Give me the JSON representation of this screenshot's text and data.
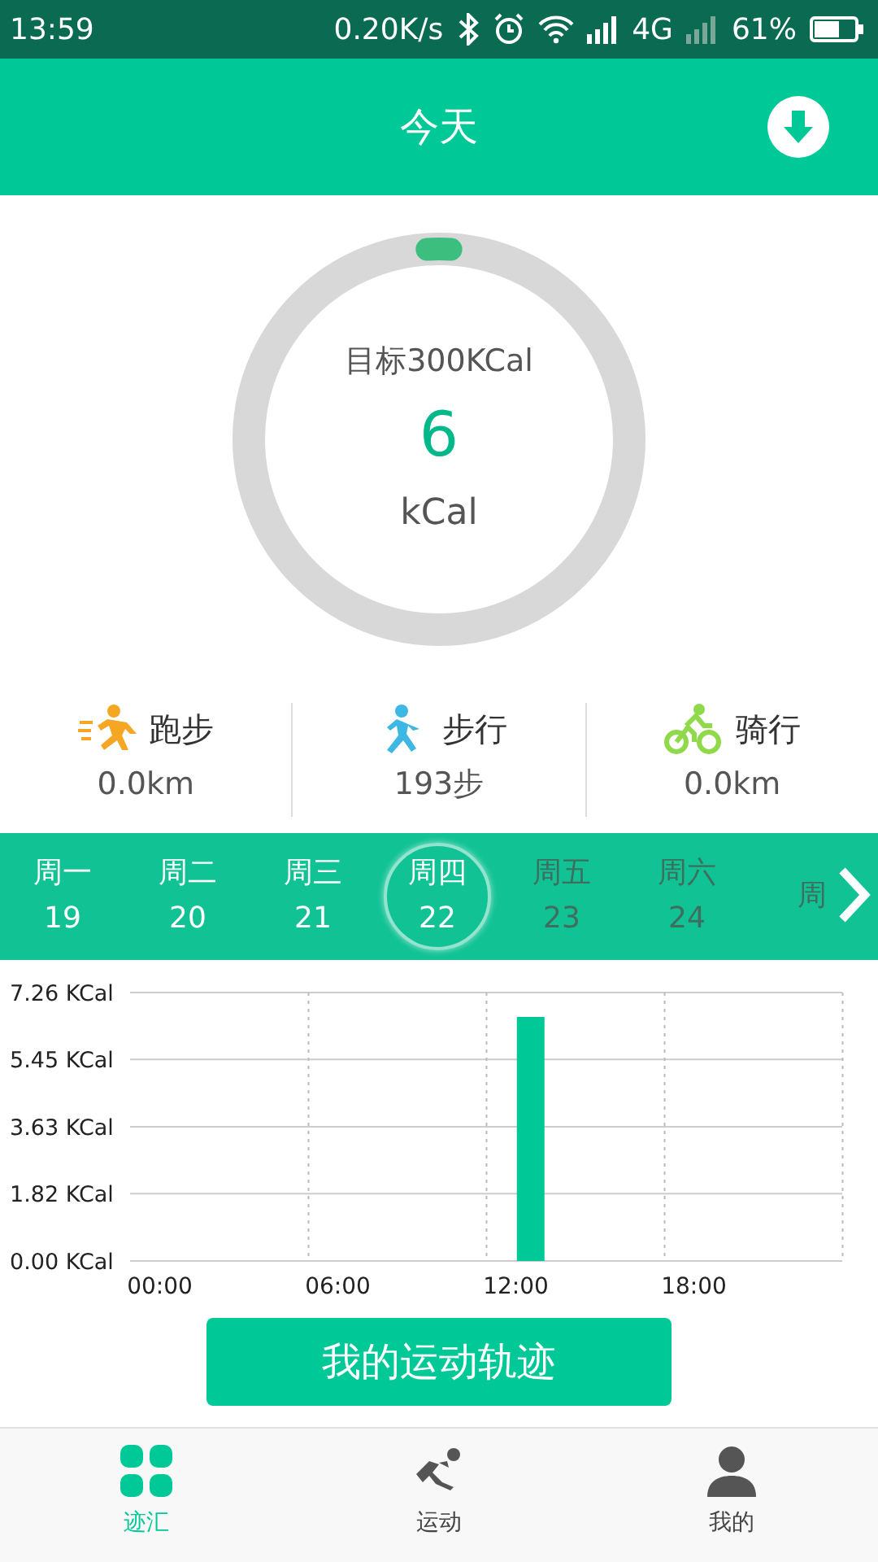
{
  "status_bar": {
    "time": "13:59",
    "speed": "0.20K/s",
    "network": "4G",
    "battery": "61%"
  },
  "header": {
    "title": "今天"
  },
  "goal": {
    "target": "目标300KCal",
    "value": "6",
    "unit": "kCal",
    "level": 0.02
  },
  "stats": [
    {
      "kind": "run",
      "label": "跑步",
      "value": "0.0km"
    },
    {
      "kind": "walk",
      "label": "步行",
      "value": "193步"
    },
    {
      "kind": "ride",
      "label": "骑行",
      "value": "0.0km"
    }
  ],
  "week": [
    {
      "label": "周一",
      "date": "19",
      "selected": false,
      "disabled": false
    },
    {
      "label": "周二",
      "date": "20",
      "selected": false,
      "disabled": false
    },
    {
      "label": "周三",
      "date": "21",
      "selected": false,
      "disabled": false
    },
    {
      "label": "周四",
      "date": "22",
      "selected": true,
      "disabled": false
    },
    {
      "label": "周五",
      "date": "23",
      "selected": false,
      "disabled": true
    },
    {
      "label": "周六",
      "date": "24",
      "selected": false,
      "disabled": true
    },
    {
      "label": "周",
      "selected": false,
      "disabled": true
    }
  ],
  "chart": {
    "chart_data": {
      "type": "bar",
      "grid": true,
      "xlim": [
        -1,
        23
      ],
      "ylim": [
        0,
        7.26
      ],
      "xticks": [
        {
          "value": 0,
          "label": "00:00"
        },
        {
          "value": 6,
          "label": "06:00"
        },
        {
          "value": 12,
          "label": "12:00"
        },
        {
          "value": 18,
          "label": "18:00"
        }
      ],
      "yticks": [
        {
          "value": 0,
          "label": "0.00 KCal"
        },
        {
          "value": 1.82,
          "label": "1.82 KCal"
        },
        {
          "value": 3.63,
          "label": "3.63 KCal"
        },
        {
          "value": 5.45,
          "label": "5.45 KCal"
        },
        {
          "value": 7.26,
          "label": "7.26 KCal"
        }
      ],
      "x": [
        12.5
      ],
      "series": [
        {
          "color": "#00c896",
          "values": [
            6.6
          ]
        }
      ]
    }
  },
  "track_button": "我的运动轨迹",
  "nav": [
    {
      "kind": "summary",
      "label": "迹汇",
      "selected": true
    },
    {
      "kind": "sport",
      "label": "运动",
      "selected": false
    },
    {
      "kind": "me",
      "label": "我的",
      "selected": false
    }
  ]
}
